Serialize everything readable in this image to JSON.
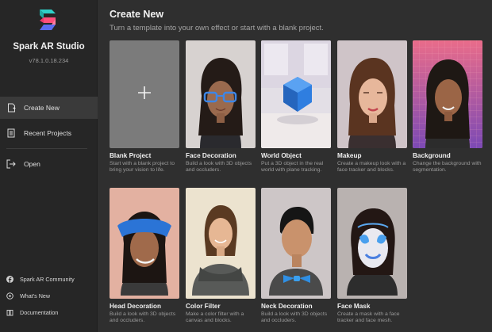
{
  "app": {
    "name": "Spark AR Studio",
    "version": "v78.1.0.18.234"
  },
  "sidebar": {
    "nav": [
      {
        "label": "Create New",
        "icon": "create-new-icon",
        "active": true
      },
      {
        "label": "Recent Projects",
        "icon": "recent-projects-icon",
        "active": false
      },
      {
        "label": "Open",
        "icon": "open-icon",
        "active": false
      }
    ],
    "footer": [
      {
        "label": "Spark AR Community",
        "icon": "facebook-icon"
      },
      {
        "label": "What's New",
        "icon": "whats-new-icon"
      },
      {
        "label": "Documentation",
        "icon": "documentation-icon"
      }
    ]
  },
  "main": {
    "title": "Create New",
    "subtitle": "Turn a template into your own effect or start with a blank project.",
    "templates": [
      {
        "title": "Blank Project",
        "desc": "Start with a blank project to bring your vision to life.",
        "icon": "plus-icon"
      },
      {
        "title": "Face Decoration",
        "desc": "Build a look with 3D objects and occluders."
      },
      {
        "title": "World Object",
        "desc": "Put a 3D object in the real world with plane tracking."
      },
      {
        "title": "Makeup",
        "desc": "Create a makeup look with a face tracker and blocks."
      },
      {
        "title": "Background",
        "desc": "Change the background with segmentation."
      },
      {
        "title": "Head Decoration",
        "desc": "Build a look with 3D objects and occluders."
      },
      {
        "title": "Color Filter",
        "desc": "Make a color filter with a canvas and blocks."
      },
      {
        "title": "Neck Decoration",
        "desc": "Build a look with 3D objects and occluders."
      },
      {
        "title": "Face Mask",
        "desc": "Create a mask with a face tracker and face mesh."
      }
    ]
  },
  "colors": {
    "sidebar_bg": "#262626",
    "main_bg": "#2f2f2f",
    "active_nav_bg": "#3a3a3a",
    "logo_teal": "#2fd0c8",
    "logo_pink": "#ff4f7b",
    "accent_blue": "#3b8fe8"
  }
}
